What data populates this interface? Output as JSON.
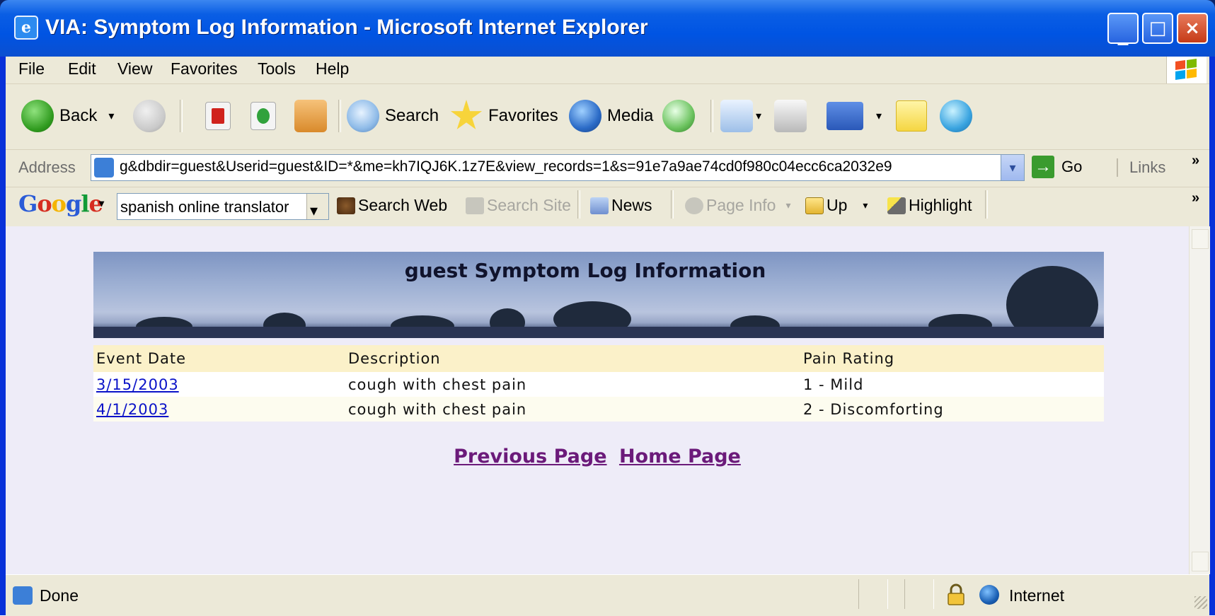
{
  "window": {
    "title": "VIA: Symptom Log Information - Microsoft Internet Explorer",
    "controls": {
      "minimize": "_",
      "maximize": "□",
      "close": "×"
    }
  },
  "menu": {
    "items": [
      "File",
      "Edit",
      "View",
      "Favorites",
      "Tools",
      "Help"
    ]
  },
  "toolbar": {
    "back_label": "Back",
    "search_label": "Search",
    "favorites_label": "Favorites",
    "media_label": "Media",
    "dropdown_glyph": "▾"
  },
  "addressbar": {
    "label": "Address",
    "url": "g&dbdir=guest&Userid=guest&ID=*&me=kh7IQJ6K.1z7E&view_records=1&s=91e7a9ae74cd0f980c04ecc6ca2032e9",
    "go_label": "Go",
    "links_label": "Links",
    "overflow_glyph": "»"
  },
  "googlebar": {
    "logo": "Google",
    "search_value": "spanish online translator",
    "search_web_label": "Search Web",
    "search_site_label": "Search Site",
    "news_label": "News",
    "page_info_label": "Page Info",
    "up_label": "Up",
    "highlight_label": "Highlight",
    "overflow_glyph": "»"
  },
  "page": {
    "banner_title": "guest Symptom Log Information",
    "table": {
      "headers": [
        "Event Date",
        "Description",
        "Pain Rating"
      ],
      "rows": [
        {
          "date": "3/15/2003",
          "description": "cough with chest pain",
          "pain": "1 - Mild"
        },
        {
          "date": "4/1/2003",
          "description": "cough with chest pain",
          "pain": "2 - Discomforting"
        }
      ]
    },
    "nav": {
      "previous": "Previous Page",
      "home": "Home Page"
    }
  },
  "status": {
    "text": "Done",
    "zone": "Internet"
  },
  "colors": {
    "titlebar": "#0054e3",
    "link": "#0a12c8",
    "visited_link": "#6b1a7a",
    "table_header_bg": "#fbf1c9",
    "page_bg": "#eeecf8"
  },
  "icons": [
    "ie-icon",
    "back-icon",
    "forward-icon",
    "stop-icon",
    "refresh-icon",
    "home-icon",
    "search-icon",
    "favorites-star-icon",
    "media-icon",
    "history-icon",
    "mail-icon",
    "print-icon",
    "edit-icon",
    "note-icon",
    "messenger-icon",
    "page-icon",
    "go-arrow-icon",
    "lock-icon",
    "internet-zone-icon"
  ]
}
